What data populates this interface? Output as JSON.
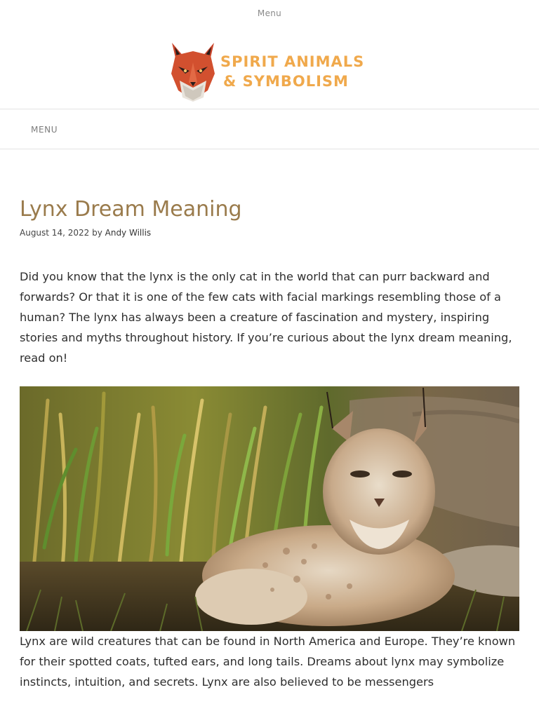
{
  "header": {
    "top_menu_label": "Menu",
    "logo": {
      "line1": "SPIRIT ANIMALS",
      "line2": "& SYMBOLISM",
      "icon": "fox-head-icon"
    },
    "nav_menu_label": "MENU"
  },
  "article": {
    "title": "Lynx Dream Meaning",
    "date": "August 14, 2022",
    "by": "by",
    "author": "Andy Willis",
    "intro": "Did you know that the lynx is the only cat in the world that can purr backward and forwards? Or that it is one of the few cats with facial markings resembling those of a human? The lynx has always been a creature of fascination and mystery, inspiring stories and myths throughout history. If you’re curious about the lynx dream meaning, read on!",
    "body": "Lynx are wild creatures that can be found in North America and Europe. They’re known for their spotted coats, tufted ears, and long tails. Dreams about lynx may symbolize instincts, intuition, and secrets. Lynx are also believed to be messengers"
  },
  "colors": {
    "title": "#9a7b4c",
    "logo_text": "#f0a94c",
    "fox": "#d2502f"
  }
}
